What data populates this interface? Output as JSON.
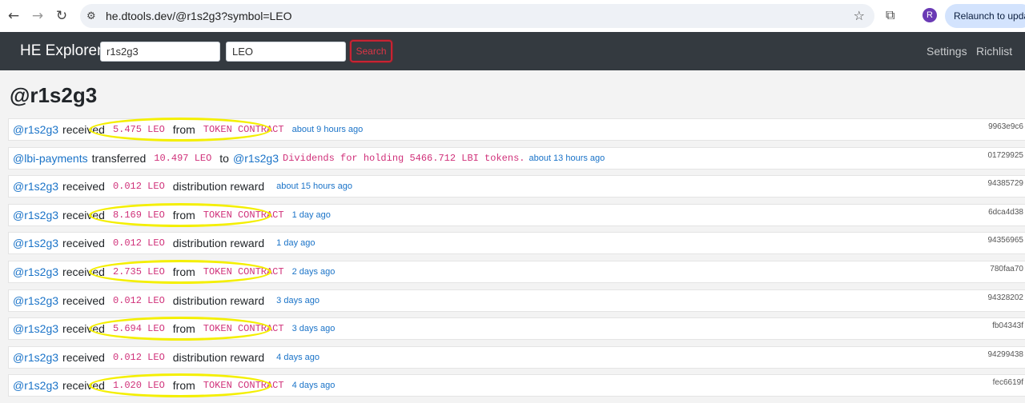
{
  "browser": {
    "url": "he.dtools.dev/@r1s2g3?symbol=LEO",
    "profile_initial": "R",
    "relaunch_label": "Relaunch to update"
  },
  "navbar": {
    "brand": "HE Explorer",
    "account_value": "r1s2g3",
    "symbol_value": "LEO",
    "search_label": "Search",
    "settings_label": "Settings",
    "richlist_label": "Richlist"
  },
  "page": {
    "title": "@r1s2g3"
  },
  "transactions": [
    {
      "actor": "@r1s2g3",
      "verb": "received",
      "amount": "5.475 LEO",
      "connector": "from",
      "target": "TOKEN CONTRACT",
      "time": "about 9 hours ago",
      "hash": "9963e9c6",
      "highlighted": true
    },
    {
      "actor": "@lbi-payments",
      "verb": "transferred",
      "amount": "10.497 LEO",
      "connector": "to",
      "target_user": "@r1s2g3",
      "memo": "Dividends for holding 5466.712 LBI tokens.",
      "time": "about 13 hours ago",
      "hash": "01729925",
      "highlighted": false
    },
    {
      "actor": "@r1s2g3",
      "verb": "received",
      "amount": "0.012 LEO",
      "connector": "distribution reward",
      "time": "about 15 hours ago",
      "hash": "94385729",
      "highlighted": false
    },
    {
      "actor": "@r1s2g3",
      "verb": "received",
      "amount": "8.169 LEO",
      "connector": "from",
      "target": "TOKEN CONTRACT",
      "time": "1 day ago",
      "hash": "6dca4d38",
      "highlighted": true
    },
    {
      "actor": "@r1s2g3",
      "verb": "received",
      "amount": "0.012 LEO",
      "connector": "distribution reward",
      "time": "1 day ago",
      "hash": "94356965",
      "highlighted": false
    },
    {
      "actor": "@r1s2g3",
      "verb": "received",
      "amount": "2.735 LEO",
      "connector": "from",
      "target": "TOKEN CONTRACT",
      "time": "2 days ago",
      "hash": "780faa70",
      "highlighted": true
    },
    {
      "actor": "@r1s2g3",
      "verb": "received",
      "amount": "0.012 LEO",
      "connector": "distribution reward",
      "time": "3 days ago",
      "hash": "94328202",
      "highlighted": false
    },
    {
      "actor": "@r1s2g3",
      "verb": "received",
      "amount": "5.694 LEO",
      "connector": "from",
      "target": "TOKEN CONTRACT",
      "time": "3 days ago",
      "hash": "fb04343f",
      "highlighted": true
    },
    {
      "actor": "@r1s2g3",
      "verb": "received",
      "amount": "0.012 LEO",
      "connector": "distribution reward",
      "time": "4 days ago",
      "hash": "94299438",
      "highlighted": false
    },
    {
      "actor": "@r1s2g3",
      "verb": "received",
      "amount": "1.020 LEO",
      "connector": "from",
      "target": "TOKEN CONTRACT",
      "time": "4 days ago",
      "hash": "fec6619f",
      "highlighted": true
    }
  ],
  "colors": {
    "navbar_bg": "#343a40",
    "link": "#1a73c8",
    "mono_text": "#d0317a",
    "highlight": "#f4ef00",
    "search_border": "#c82333"
  }
}
